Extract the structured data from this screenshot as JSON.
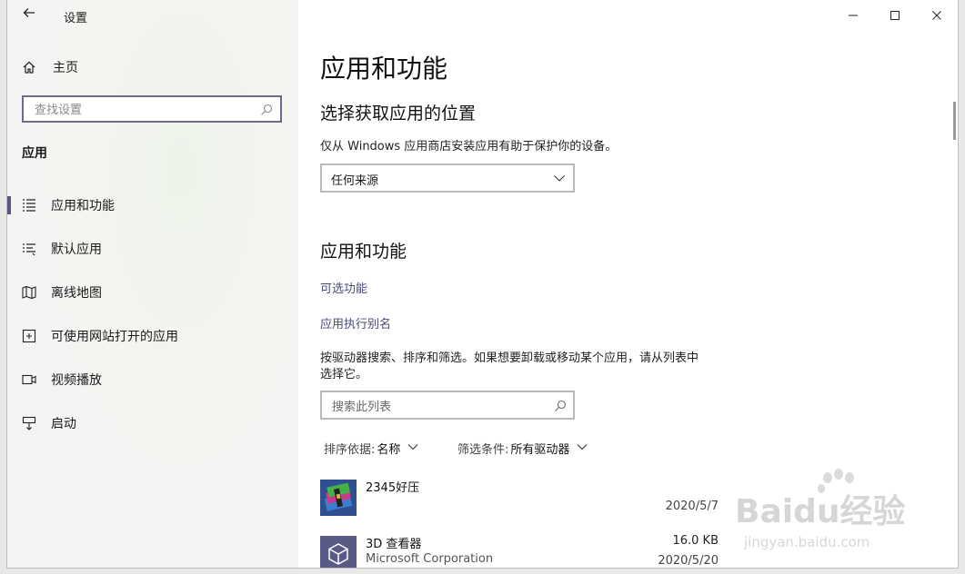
{
  "window": {
    "title": "设置"
  },
  "nav": {
    "home_label": "主页",
    "search_placeholder": "查找设置",
    "section_label": "应用",
    "items": [
      {
        "label": "应用和功能",
        "icon": "list-icon",
        "active": true
      },
      {
        "label": "默认应用",
        "icon": "default-apps-icon",
        "active": false
      },
      {
        "label": "离线地图",
        "icon": "map-icon",
        "active": false
      },
      {
        "label": "可使用网站打开的应用",
        "icon": "open-in-icon",
        "active": false
      },
      {
        "label": "视频播放",
        "icon": "video-icon",
        "active": false
      },
      {
        "label": "启动",
        "icon": "startup-icon",
        "active": false
      }
    ]
  },
  "main": {
    "title": "应用和功能",
    "source_heading": "选择获取应用的位置",
    "source_desc": "仅从 Windows 应用商店安装应用有助于保护你的设备。",
    "source_selected": "任何来源",
    "apps_heading": "应用和功能",
    "optional_features_link": "可选功能",
    "app_alias_link": "应用执行别名",
    "search_desc_line1": "按驱动器搜索、排序和筛选。如果想要卸载或移动某个应用，请从列表中",
    "search_desc_line2": "选择它。",
    "search_placeholder": "搜索此列表",
    "sort_label": "排序依据:",
    "sort_value": "名称",
    "filter_label": "筛选条件:",
    "filter_value": "所有驱动器",
    "apps": [
      {
        "name": "2345好压",
        "publisher": "",
        "size": "",
        "date": "2020/5/7",
        "icon": "archive-books-icon"
      },
      {
        "name": "3D 查看器",
        "publisher": "Microsoft Corporation",
        "size": "16.0 KB",
        "date": "2020/5/20",
        "icon": "3d-cube-icon"
      }
    ]
  },
  "watermark": {
    "brand": "Baidu经验",
    "url": "jingyan.baidu.com"
  }
}
